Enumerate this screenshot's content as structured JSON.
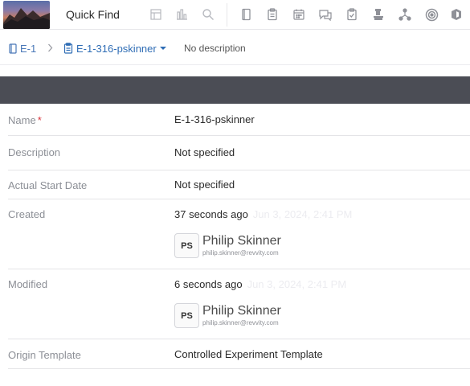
{
  "topbar": {
    "quick_find": "Quick Find",
    "icons": [
      "layout-icon",
      "bar-chart-icon",
      "search-icon",
      "notebook-icon",
      "clipboard-icon",
      "calendar-icon",
      "comments-icon",
      "clipboard-check-icon",
      "flask-icon",
      "network-icon",
      "target-icon",
      "badge-icon"
    ]
  },
  "breadcrumb": {
    "experiment": "E-1",
    "entry": "E-1-316-pskinner",
    "description": "No description"
  },
  "properties": {
    "name_label": "Name",
    "name_required": "*",
    "name_value": "E-1-316-pskinner",
    "description_label": "Description",
    "description_value": "Not specified",
    "start_label": "Actual Start Date",
    "start_value": "Not specified",
    "created_label": "Created",
    "created_relative": "37 seconds ago",
    "created_date": "Jun 3, 2024, 2:41 PM",
    "created_by": {
      "initials": "PS",
      "name": "Philip Skinner",
      "email": "philip.skinner@revvity.com"
    },
    "modified_label": "Modified",
    "modified_relative": "6 seconds ago",
    "modified_date": "Jun 3, 2024, 2:41 PM",
    "modified_by": {
      "initials": "PS",
      "name": "Philip Skinner",
      "email": "philip.skinner@revvity.com"
    },
    "template_label": "Origin Template",
    "template_value": "Controlled Experiment Template"
  },
  "colors": {
    "link": "#2f6db5",
    "dark_band": "#4b4d55",
    "required": "#d9363e",
    "label": "#8c8f96"
  }
}
